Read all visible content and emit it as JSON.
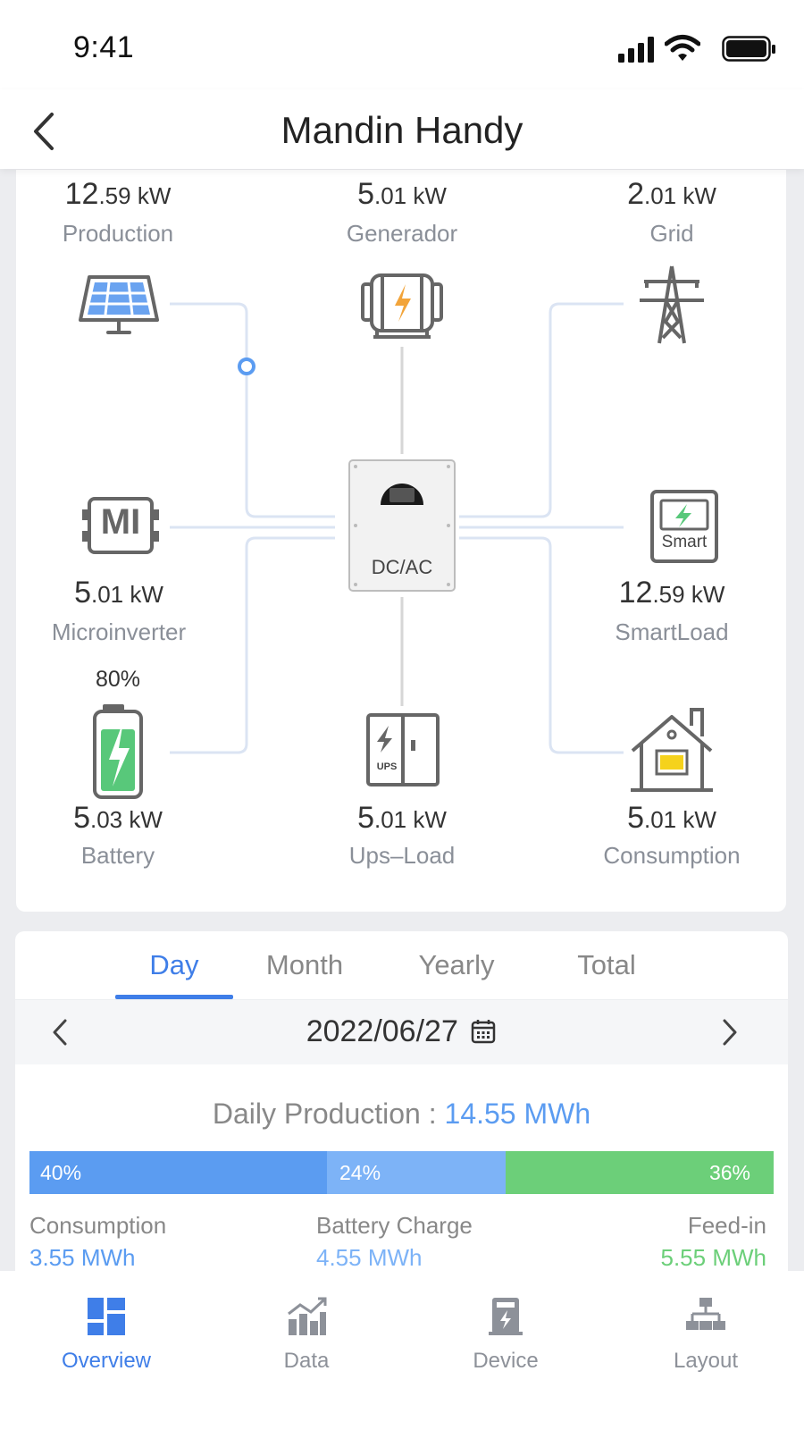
{
  "status": {
    "time": "9:41"
  },
  "header": {
    "title": "Mandin Handy"
  },
  "flow": {
    "inverter_label": "DC/AC",
    "nodes": {
      "production": {
        "int": "12",
        "dec": ".59",
        "unit": " kW",
        "label": "Production"
      },
      "generator": {
        "int": "5",
        "dec": ".01",
        "unit": " kW",
        "label": "Generador"
      },
      "grid": {
        "int": "2",
        "dec": ".01",
        "unit": " kW",
        "label": "Grid"
      },
      "microinverter": {
        "int": "5",
        "dec": ".01",
        "unit": " kW",
        "label": "Microinverter"
      },
      "smartload": {
        "int": "12",
        "dec": ".59",
        "unit": " kW",
        "label": "SmartLoad",
        "icon_text": "Smart"
      },
      "battery": {
        "int": "5",
        "dec": ".03",
        "unit": " kW",
        "label": "Battery",
        "soc": "80%"
      },
      "upsload": {
        "int": "5",
        "dec": ".01",
        "unit": " kW",
        "label": "Ups–Load",
        "icon_text": "UPS"
      },
      "consumption": {
        "int": "5",
        "dec": ".01",
        "unit": " kW",
        "label": "Consumption"
      }
    },
    "mi_icon_text": "MI"
  },
  "tabs": [
    {
      "label": "Day",
      "active": true
    },
    {
      "label": "Month",
      "active": false
    },
    {
      "label": "Yearly",
      "active": false
    },
    {
      "label": "Total",
      "active": false
    }
  ],
  "date": {
    "value": "2022/06/27"
  },
  "daily_production": {
    "label": "Daily Production : ",
    "value": "14.55 MWh"
  },
  "breakdown": {
    "segments": [
      {
        "name": "Consumption",
        "percent_label": "40%",
        "percent": 40,
        "value": "3.55 MWh",
        "color": "#5b9cf1"
      },
      {
        "name": "Battery Charge",
        "percent_label": "24%",
        "percent": 24,
        "value": "4.55 MWh",
        "color": "#7db3f7"
      },
      {
        "name": "Feed-in",
        "percent_label": "36%",
        "percent": 36,
        "value": "5.55 MWh",
        "color": "#6ccf79"
      }
    ]
  },
  "colors": {
    "accent": "#3f7ee8",
    "line": "#dbe4f3",
    "green": "#58c87a"
  },
  "nav": [
    {
      "label": "Overview",
      "icon": "overview-icon",
      "active": true
    },
    {
      "label": "Data",
      "icon": "data-icon",
      "active": false
    },
    {
      "label": "Device",
      "icon": "device-icon",
      "active": false
    },
    {
      "label": "Layout",
      "icon": "layout-icon",
      "active": false
    }
  ]
}
